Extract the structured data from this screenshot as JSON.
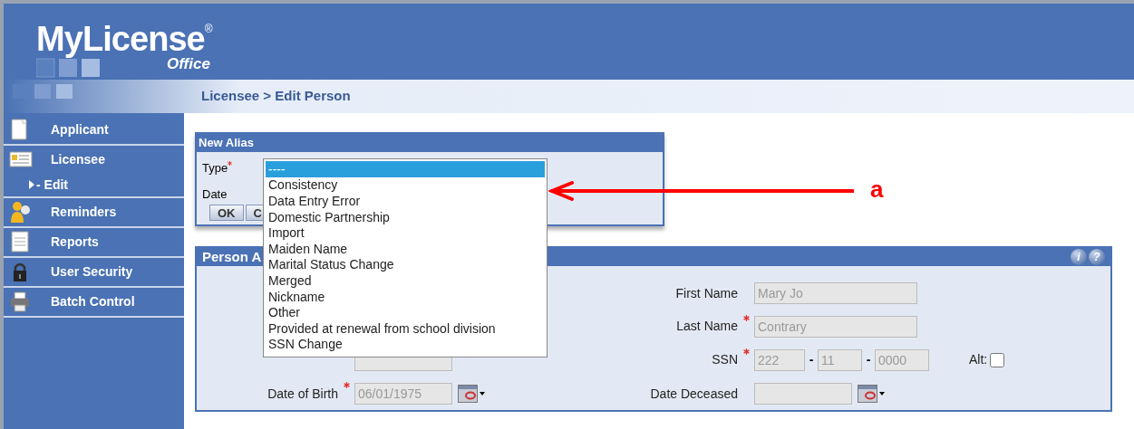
{
  "header": {
    "logo": "MyLicense",
    "registered": "®",
    "subtitle": "Office"
  },
  "breadcrumb": "Licensee > Edit Person",
  "sidebar": {
    "items": [
      {
        "label": "Applicant",
        "kind": "document"
      },
      {
        "label": "Licensee",
        "kind": "card",
        "children": [
          {
            "label": "- Edit"
          }
        ]
      },
      {
        "label": "Reminders",
        "kind": "people"
      },
      {
        "label": "Reports",
        "kind": "report"
      },
      {
        "label": "User Security",
        "kind": "lock"
      },
      {
        "label": "Batch Control",
        "kind": "printer"
      }
    ]
  },
  "new_alias": {
    "title": "New Alias",
    "fields": [
      {
        "label": "Type",
        "required": true
      },
      {
        "label": "Date",
        "required": false
      }
    ],
    "buttons": [
      "OK",
      "C"
    ]
  },
  "dropdown": {
    "options": [
      {
        "label": "----",
        "selected": true
      },
      {
        "label": "Consistency",
        "selected": false
      },
      {
        "label": "Data Entry Error",
        "selected": false
      },
      {
        "label": "Domestic Partnership",
        "selected": false
      },
      {
        "label": "Import",
        "selected": false
      },
      {
        "label": "Maiden Name",
        "selected": false
      },
      {
        "label": "Marital Status Change",
        "selected": false
      },
      {
        "label": "Merged",
        "selected": false
      },
      {
        "label": "Nickname",
        "selected": false
      },
      {
        "label": "Other",
        "selected": false
      },
      {
        "label": "Provided at renewal from school division",
        "selected": false
      },
      {
        "label": "SSN Change",
        "selected": false
      }
    ]
  },
  "person_panel": {
    "title": "Person A",
    "header_icons": [
      "i",
      "?"
    ],
    "left_fields": [
      {
        "kind": "text",
        "disabled": true
      },
      {
        "kind": "date",
        "label": "Date of Birth",
        "required": true,
        "value": "06/01/1975",
        "disabled": true
      }
    ],
    "right_fields": [
      {
        "kind": "text",
        "label": "First Name",
        "required": false,
        "value": "Mary Jo",
        "disabled": true
      },
      {
        "kind": "text",
        "label": "Last Name",
        "required": true,
        "value": "Contrary",
        "disabled": true
      },
      {
        "kind": "ssn",
        "label": "SSN",
        "required": true,
        "parts": [
          "222",
          "11",
          "0000"
        ],
        "separators": [
          "-",
          "-"
        ],
        "alt_label": "Alt:",
        "alt_checked": false,
        "disabled": true
      },
      {
        "kind": "date",
        "label": "Date Deceased",
        "required": false,
        "disabled": true
      }
    ]
  },
  "annotation": {
    "label": "a"
  }
}
